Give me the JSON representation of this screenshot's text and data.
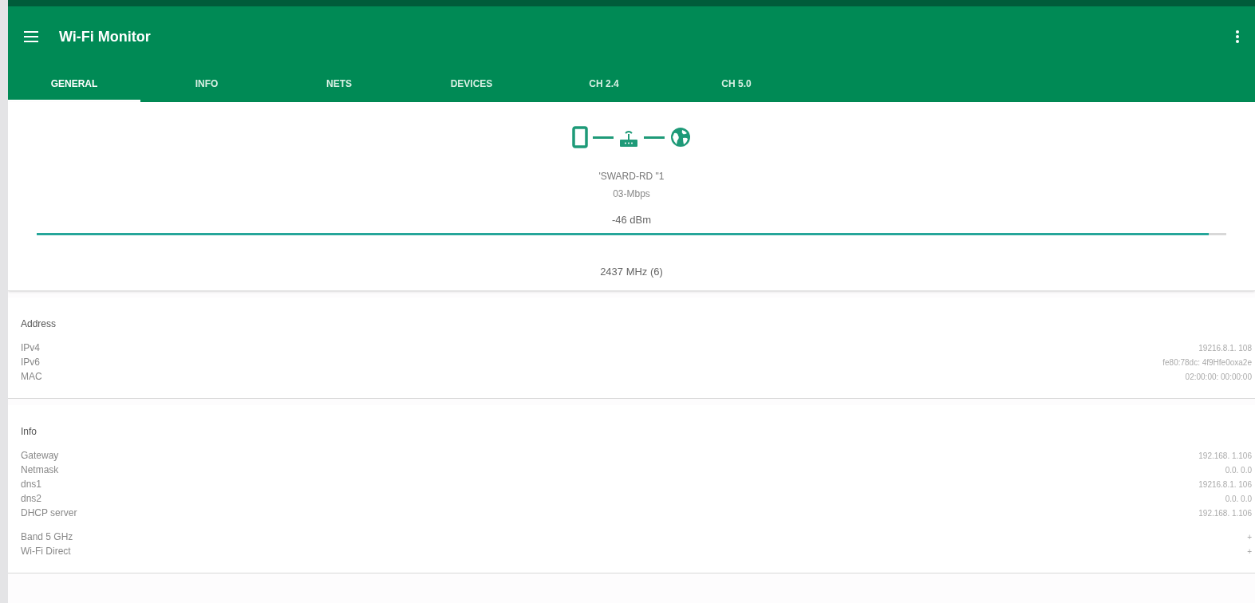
{
  "app_bar": {
    "title": "Wi-Fi Monitor"
  },
  "tabs": [
    {
      "label": "GENERAL",
      "selected": true
    },
    {
      "label": "INFO",
      "selected": false
    },
    {
      "label": "NETS",
      "selected": false
    },
    {
      "label": "DEVICES",
      "selected": false
    },
    {
      "label": "CH 2.4",
      "selected": false
    },
    {
      "label": "CH 5.0",
      "selected": false
    }
  ],
  "connection": {
    "ssid": "'SWARD-RD \"1",
    "speed": "03-Mbps",
    "signal": {
      "reading": "-46 dBm",
      "level": 0.985
    },
    "frequency": "2437 MHz (6)"
  },
  "sections": [
    {
      "title": "Address",
      "groups": [
        [
          {
            "label": "IPv4",
            "value": "19216.8.1. 108"
          },
          {
            "label": "IPv6",
            "value": "fe80:78dc: 4f9Hfe0oxa2e"
          },
          {
            "label": "MAC",
            "value": "02:00:00: 00:00:00"
          }
        ]
      ]
    },
    {
      "title": "Info",
      "groups": [
        [
          {
            "label": "Gateway",
            "value": "192.168. 1.106"
          },
          {
            "label": "Netmask",
            "value": "0.0. 0.0"
          },
          {
            "label": "dns1",
            "value": "19216.8.1. 106"
          },
          {
            "label": "dns2",
            "value": "0.0. 0.0"
          },
          {
            "label": "DHCP server",
            "value": "192.168. 1.106"
          }
        ],
        [
          {
            "label": "Band 5 GHz",
            "value": "+"
          },
          {
            "label": "Wi-Fi Direct",
            "value": "+"
          }
        ]
      ]
    }
  ]
}
